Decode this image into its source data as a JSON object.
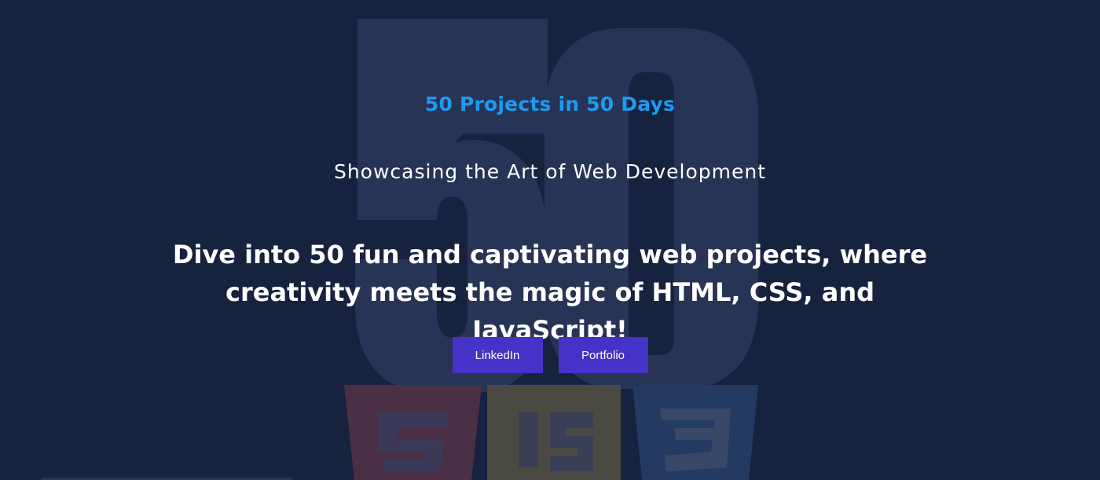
{
  "hero": {
    "kicker": "50 Projects in 50 Days",
    "subtitle": "Showcasing the Art of Web Development",
    "headline": "Dive into 50 fun and captivating web projects, where creativity meets the magic of HTML, CSS, and JavaScript!",
    "background_art": {
      "big_number": "50",
      "logo_icons": [
        "html5-icon",
        "javascript-icon",
        "css3-icon"
      ]
    }
  },
  "buttons": {
    "linkedin_label": "LinkedIn",
    "portfolio_label": "Portfolio"
  },
  "colors": {
    "background": "#17223f",
    "kicker": "#1d9bf0",
    "text": "#ffffff",
    "button": "#4532c8",
    "html5": "#6a3a3a",
    "javascript": "#5a5a3a",
    "css3": "#2a4a78"
  }
}
